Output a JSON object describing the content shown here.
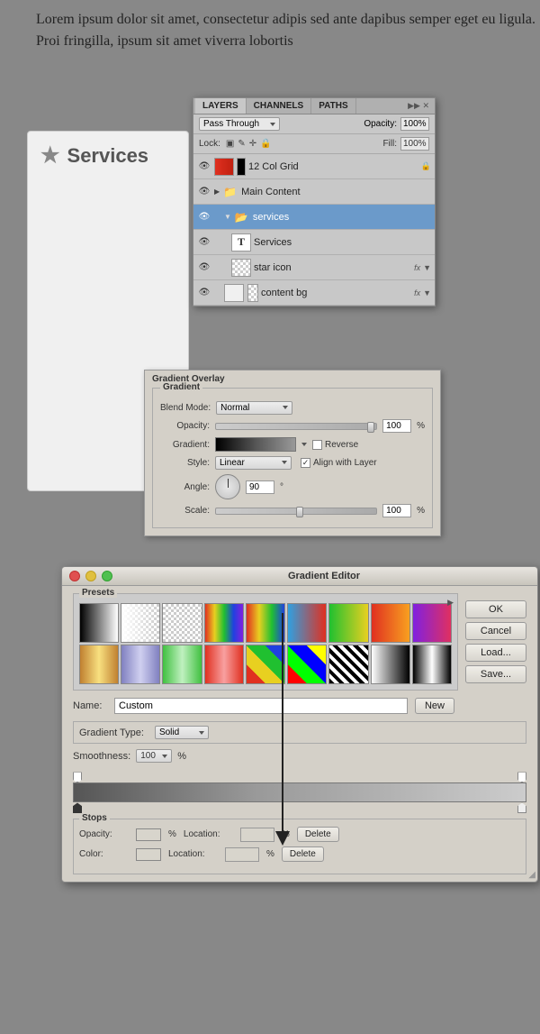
{
  "page": {
    "lorem_text": "Lorem ipsum dolor sit amet, consectetur adipis sed ante dapibus semper eget eu ligula. Proi fringilla, ipsum sit amet viverra lobortis",
    "services_title": "Services"
  },
  "layers_panel": {
    "tabs": [
      "LAYERS",
      "CHANNELS",
      "PATHS"
    ],
    "blend_mode": "Pass Through",
    "opacity_label": "Opacity:",
    "opacity_value": "100%",
    "lock_label": "Lock:",
    "fill_label": "Fill:",
    "fill_value": "100%",
    "layers": [
      {
        "name": "12 Col Grid",
        "type": "normal",
        "has_lock": true
      },
      {
        "name": "Main Content",
        "type": "group_closed",
        "indent": 0
      },
      {
        "name": "services",
        "type": "group_open",
        "indent": 1,
        "selected": true
      },
      {
        "name": "Services",
        "type": "text",
        "indent": 2
      },
      {
        "name": "star icon",
        "type": "image",
        "indent": 2,
        "has_fx": true
      },
      {
        "name": "content bg",
        "type": "image",
        "indent": 1,
        "has_fx": true
      }
    ]
  },
  "gradient_overlay": {
    "title": "Gradient Overlay",
    "section_title": "Gradient",
    "blend_mode_label": "Blend Mode:",
    "blend_mode_value": "Normal",
    "opacity_label": "Opacity:",
    "opacity_value": "100",
    "gradient_label": "Gradient:",
    "reverse_label": "Reverse",
    "style_label": "Style:",
    "style_value": "Linear",
    "align_label": "Align with Layer",
    "angle_label": "Angle:",
    "angle_value": "90",
    "scale_label": "Scale:",
    "scale_value": "100"
  },
  "gradient_editor": {
    "title": "Gradient Editor",
    "buttons": {
      "ok": "OK",
      "cancel": "Cancel",
      "load": "Load...",
      "save": "Save..."
    },
    "presets_label": "Presets",
    "name_label": "Name:",
    "name_value": "Custom",
    "new_label": "New",
    "gradient_type_label": "Gradient Type:",
    "gradient_type_value": "Solid",
    "smoothness_label": "Smoothness:",
    "smoothness_value": "100",
    "smoothness_pct": "%",
    "stops_section": {
      "label": "Stops",
      "opacity_label": "Opacity:",
      "opacity_pct": "%",
      "location_label": "Location:",
      "location_pct": "%",
      "delete_label": "Delete",
      "color_label": "Color:",
      "color_location_label": "Location:",
      "color_location_pct": "%",
      "color_delete_label": "Delete"
    }
  }
}
